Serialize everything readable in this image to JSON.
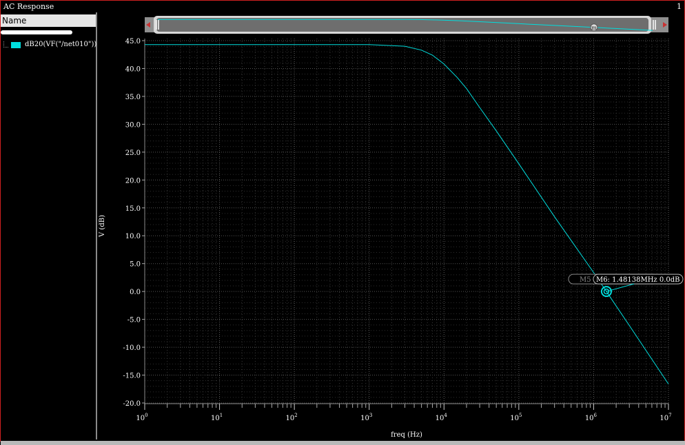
{
  "window": {
    "title": "AC Response",
    "index": "1"
  },
  "left_panel": {
    "header": "Name",
    "traces": [
      {
        "label": "dB20(VF(\"/net010\"))",
        "color": "#00dede"
      }
    ]
  },
  "colors": {
    "trace": "#00dede",
    "background": "#000000",
    "grid": "#5a5a5a",
    "border": "#d02020"
  },
  "marker": {
    "label": "M6: 1.48138MHz 0.0dB",
    "ghost_label": "M5",
    "overview_marker": "m",
    "freq_hz": 1481380,
    "value_db": 0.0
  },
  "chart_data": {
    "type": "line",
    "xlabel": "freq (Hz)",
    "ylabel": "V (dB)",
    "x_scale": "log",
    "xlim": [
      1,
      10000000
    ],
    "ylim": [
      -20,
      45
    ],
    "grid": true,
    "y_ticks": [
      "45.0",
      "40.0",
      "35.0",
      "30.0",
      "25.0",
      "20.0",
      "15.0",
      "10.0",
      "5.0",
      "0.0",
      "-5.0",
      "-10.0",
      "-15.0",
      "-20.0"
    ],
    "x_ticks": [
      "10^0",
      "10^1",
      "10^2",
      "10^3",
      "10^4",
      "10^5",
      "10^6",
      "10^7"
    ],
    "series": [
      {
        "x": [
          1,
          10,
          100,
          1000,
          3000,
          5000,
          7000,
          10000,
          15000,
          20000,
          30000,
          50000,
          100000,
          300000,
          1000000,
          1481380,
          3000000,
          10000000
        ],
        "y": [
          44.3,
          44.3,
          44.3,
          44.28,
          44.0,
          43.3,
          42.4,
          40.8,
          38.4,
          36.4,
          33.0,
          28.8,
          22.9,
          13.4,
          3.4,
          0.0,
          -6.1,
          -16.6
        ]
      }
    ]
  }
}
